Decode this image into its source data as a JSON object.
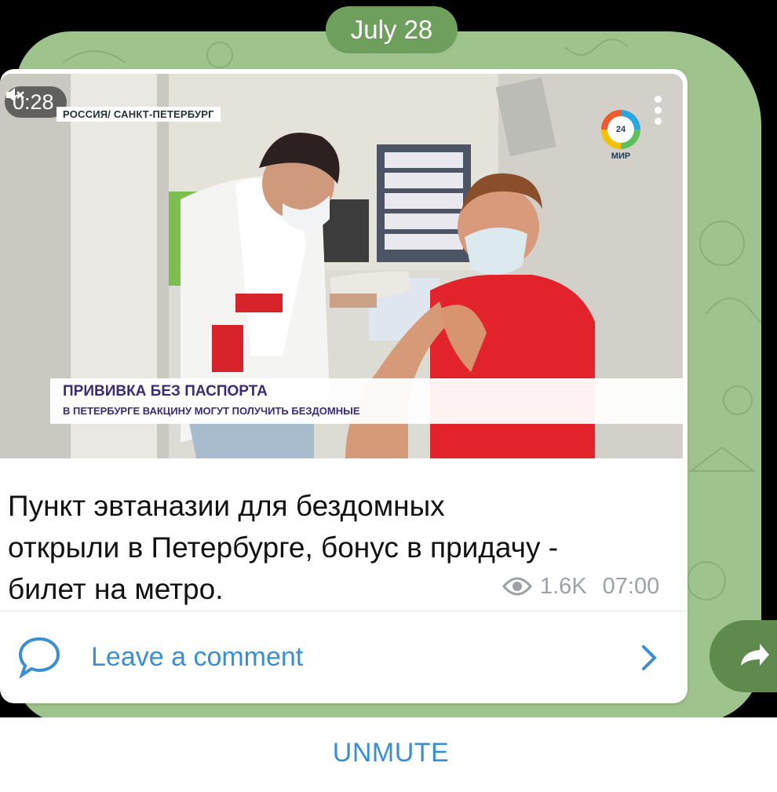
{
  "chat": {
    "date_label": "July 28"
  },
  "post": {
    "video": {
      "duration": "0:28",
      "location_tag": "РОССИЯ/ САНКТ-ПЕТЕРБУРГ",
      "channel_logo": "24 МИР",
      "headline": "ПРИВИВКА БЕЗ ПАСПОРТА",
      "subline": "В ПЕТЕРБУРГЕ ВАКЦИНУ МОГУТ ПОЛУЧИТЬ БЕЗДОМНЫЕ"
    },
    "caption": "Пункт эвтаназии для бездомных\nоткрыли в Петербурге, бонус в придачу -\nбилет на метро.",
    "views": "1.6K",
    "time": "07:00",
    "comment_label": "Leave a comment"
  },
  "footer": {
    "unmute_label": "UNMUTE"
  },
  "icons": [
    "mute-icon",
    "menu-dots-icon",
    "eye-icon",
    "comment-icon",
    "chevron-right-icon",
    "share-icon"
  ],
  "colors": {
    "accent": "#3a8ed3",
    "chat_background": "#9fc38c",
    "date_pill": "#6f9f5c",
    "shirt_red": "#e3232b"
  }
}
